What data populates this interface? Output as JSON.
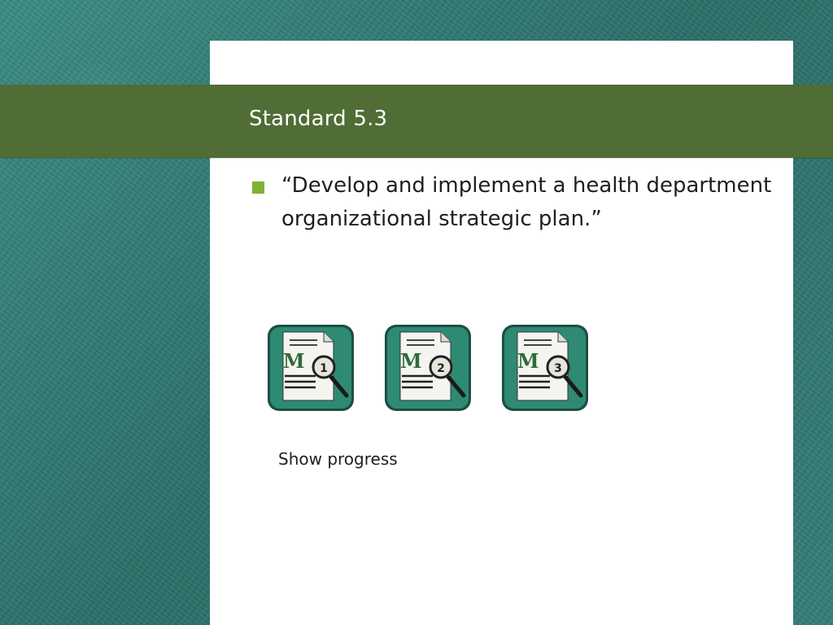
{
  "slide": {
    "title": "Standard 5.3",
    "bullet": "“Develop and implement a health department organizational strategic plan.”",
    "caption": "Show progress"
  },
  "icons": [
    {
      "name": "document-magnifier-icon-1",
      "letter": "M",
      "number": "1"
    },
    {
      "name": "document-magnifier-icon-2",
      "letter": "M",
      "number": "2"
    },
    {
      "name": "document-magnifier-icon-3",
      "letter": "M",
      "number": "3"
    }
  ],
  "colors": {
    "background_teal": "#2f7a72",
    "title_bar_green": "#4f6d35",
    "bullet_green": "#7fb235",
    "icon_tile_teal": "#2f8a73"
  }
}
